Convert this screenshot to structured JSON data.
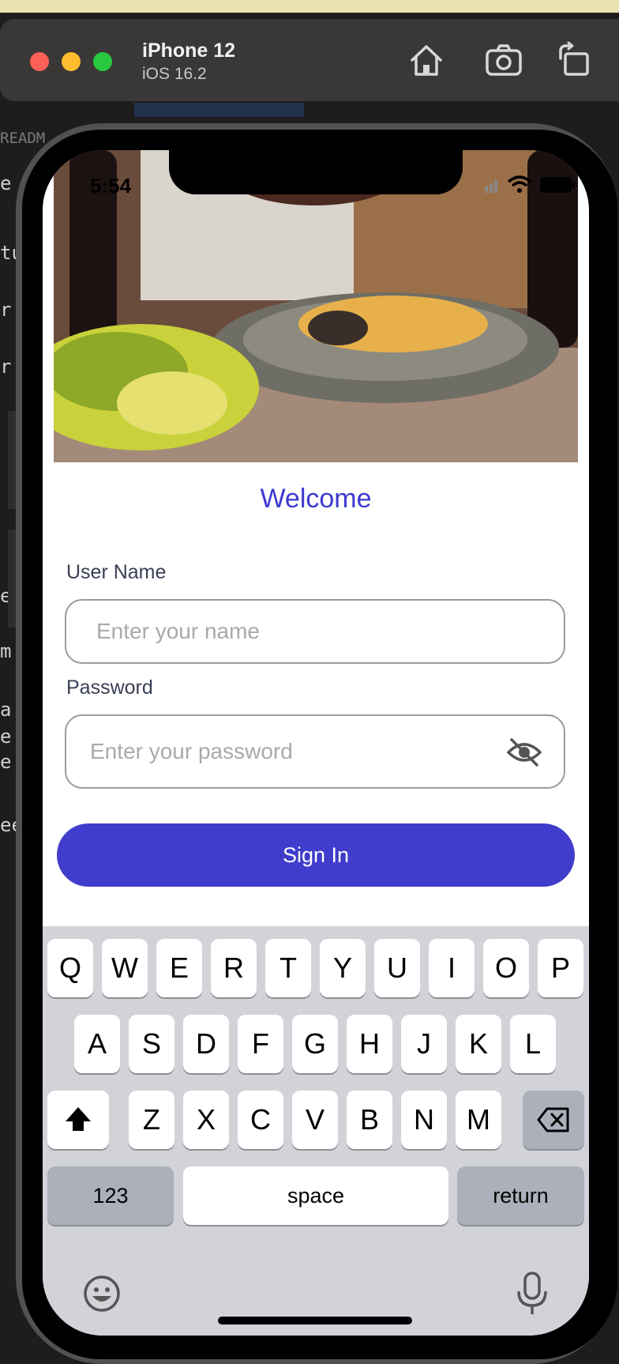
{
  "simulator": {
    "device_name": "iPhone 12",
    "os_version": "iOS 16.2",
    "toolbar_icons": [
      "home-icon",
      "screenshot-icon",
      "rotate-icon"
    ]
  },
  "background_editor": {
    "tab_label": "READM",
    "code_fragments": [
      "e",
      "tu",
      "r",
      "r",
      "e",
      "m",
      "a",
      "e",
      "e",
      "ee"
    ]
  },
  "status_bar": {
    "time": "5:54",
    "icons": [
      "signal-icon",
      "wifi-icon",
      "battery-icon"
    ]
  },
  "app": {
    "welcome": "Welcome",
    "username_label": "User Name",
    "username_placeholder": "Enter your name",
    "username_value": "",
    "password_label": "Password",
    "password_placeholder": "Enter your password",
    "password_value": "",
    "signin_label": "Sign In",
    "accent": "#403dcc"
  },
  "keyboard": {
    "row1": [
      "Q",
      "W",
      "E",
      "R",
      "T",
      "Y",
      "U",
      "I",
      "O",
      "P"
    ],
    "row2": [
      "A",
      "S",
      "D",
      "F",
      "G",
      "H",
      "J",
      "K",
      "L"
    ],
    "row3": [
      "Z",
      "X",
      "C",
      "V",
      "B",
      "N",
      "M"
    ],
    "numbers_key": "123",
    "space_key": "space",
    "return_key": "return"
  }
}
